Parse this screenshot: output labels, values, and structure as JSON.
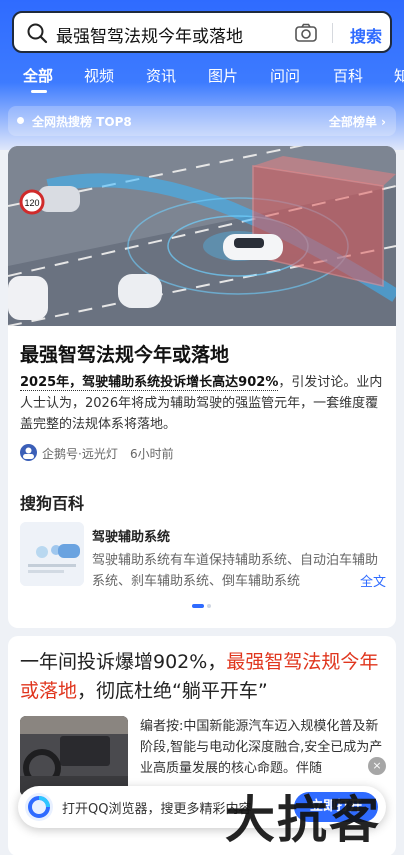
{
  "search": {
    "query": "最强智驾法规今年或落地",
    "button_label": "搜索"
  },
  "tabs": [
    "全部",
    "视频",
    "资讯",
    "图片",
    "问问",
    "百科",
    "知"
  ],
  "hot": {
    "label": "全网热搜榜 TOP8",
    "more": "全部榜单 ›"
  },
  "news": {
    "title": "最强智驾法规今年或落地",
    "summary_bold": "2025年，驾驶辅助系统投诉增长高达902%",
    "summary_rest": "，引发讨论。业内人士认为，2026年将成为辅助驾驶的强监管元年，一套维度覆盖完整的法规体系将落地。",
    "source": "企鹅号·远光灯",
    "time": "6小时前",
    "hero_sign": "120"
  },
  "baike": {
    "section_title": "搜狗百科",
    "entry_title": "驾驶辅助系统",
    "entry_desc": "驾驶辅助系统有车道保持辅助系统、自动泊车辅助系统、刹车辅助系统、倒车辅助系统",
    "more_label": "全文"
  },
  "article2": {
    "title_part1": "一年间投诉爆增902%，",
    "title_highlight": "最强智驾法规今年或落地",
    "title_part2": "，彻底杜绝“躺平开车”",
    "desc": "编者按:中国新能源汽车迈入规模化普及新阶段,智能与电动化深度融合,安全已成为产业高质量发展的核心命题。伴随"
  },
  "banner": {
    "text": "打开QQ浏览器，搜更多精彩内容",
    "button": "立即打开",
    "close": "×"
  },
  "watermark": "大抗客",
  "colors": {
    "brand_blue": "#2f6bff",
    "highlight_red": "#e0361e"
  }
}
